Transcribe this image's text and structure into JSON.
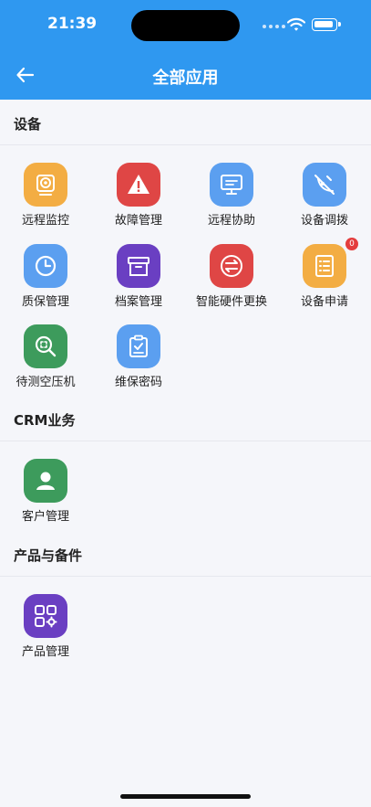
{
  "status_bar": {
    "time": "21:39"
  },
  "header": {
    "title": "全部应用"
  },
  "sections": [
    {
      "title": "设备",
      "items": [
        {
          "label": "远程监控",
          "icon": "webcam-icon",
          "color": "#f3ad43"
        },
        {
          "label": "故障管理",
          "icon": "warning-icon",
          "color": "#df4645"
        },
        {
          "label": "远程协助",
          "icon": "monitor-icon",
          "color": "#5b9ff0"
        },
        {
          "label": "设备调拨",
          "icon": "no-signal-icon",
          "color": "#5b9ff0"
        },
        {
          "label": "质保管理",
          "icon": "clock-icon",
          "color": "#5b9ff0"
        },
        {
          "label": "档案管理",
          "icon": "archive-box-icon",
          "color": "#6a3fc2"
        },
        {
          "label": "智能硬件更换",
          "icon": "exchange-icon",
          "color": "#df4645"
        },
        {
          "label": "设备申请",
          "icon": "form-list-icon",
          "color": "#f3ad43",
          "badge": "0"
        },
        {
          "label": "待测空压机",
          "icon": "scan-search-icon",
          "color": "#3d9b5c"
        },
        {
          "label": "维保密码",
          "icon": "clipboard-check-icon",
          "color": "#5b9ff0"
        }
      ]
    },
    {
      "title": "CRM业务",
      "items": [
        {
          "label": "客户管理",
          "icon": "user-icon",
          "color": "#3d9b5c"
        }
      ]
    },
    {
      "title": "产品与备件",
      "items": [
        {
          "label": "产品管理",
          "icon": "apps-grid-icon",
          "color": "#6a3fc2"
        }
      ]
    }
  ]
}
